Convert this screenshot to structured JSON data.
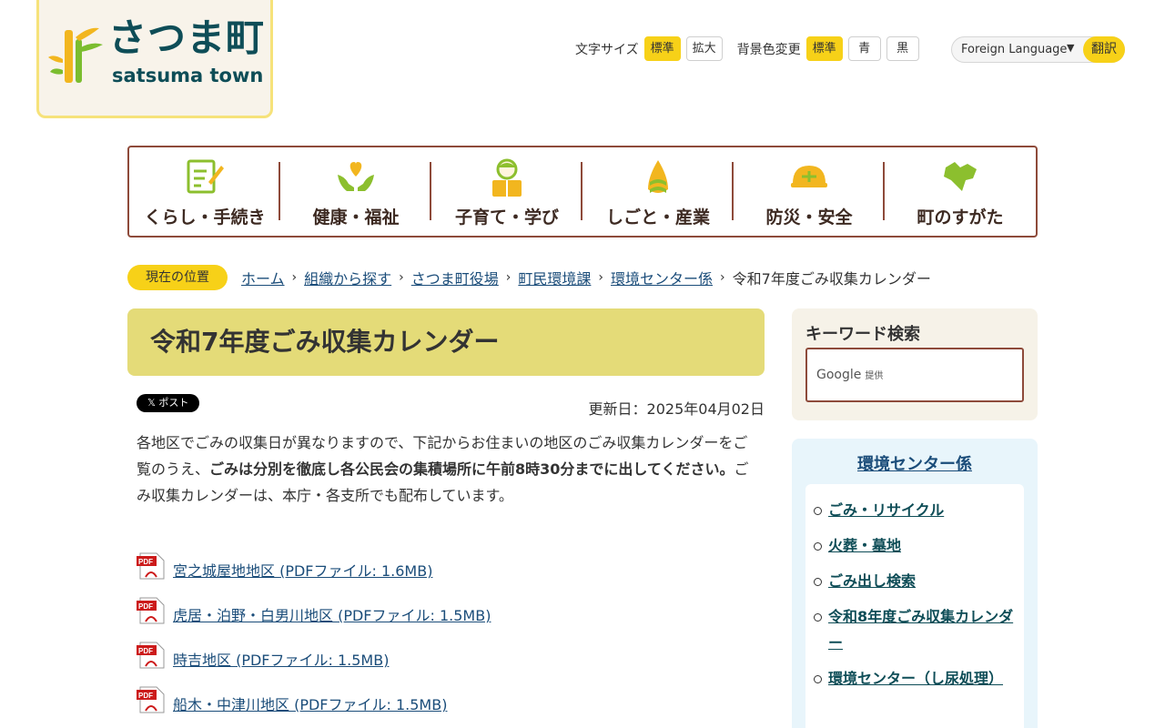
{
  "logo": {
    "jp": "さつま町",
    "en": "satsuma town"
  },
  "tools": {
    "font_label": "文字サイズ",
    "font_standard": "標準",
    "font_large": "拡大",
    "bg_label": "背景色変更",
    "bg_standard": "標準",
    "bg_blue": "青",
    "bg_black": "黒",
    "language_select": "Foreign Language",
    "translate": "翻訳"
  },
  "nav": [
    {
      "label": "くらし・手続き",
      "icon": "document-pen-icon"
    },
    {
      "label": "健康・福祉",
      "icon": "heart-hands-icon"
    },
    {
      "label": "子育て・学び",
      "icon": "child-book-icon"
    },
    {
      "label": "しごと・産業",
      "icon": "bamboo-shoot-icon"
    },
    {
      "label": "防災・安全",
      "icon": "helmet-icon"
    },
    {
      "label": "町のすがた",
      "icon": "town-map-icon"
    }
  ],
  "breadcrumb": {
    "here": "現在の位置",
    "items": [
      "ホーム",
      "組織から探す",
      "さつま町役場",
      "町民環境課",
      "環境センター係"
    ],
    "current": "令和7年度ごみ収集カレンダー"
  },
  "page": {
    "title": "令和7年度ごみ収集カレンダー",
    "post": "𝕏 ポスト",
    "updated": "更新日：2025年04月02日",
    "intro_1": "各地区でごみの収集日が異なりますので、下記からお住まいの地区のごみ収集カレンダーをご覧のうえ、",
    "intro_bold": "ごみは分別を徹底し各公民会の集積場所に午前8時30分までに出してください。",
    "intro_2": "ごみ収集カレンダーは、本庁・各支所でも配布しています。",
    "pdfs": [
      "宮之城屋地地区 (PDFファイル: 1.6MB)",
      "虎居・泊野・白男川地区 (PDFファイル: 1.5MB)",
      "時吉地区 (PDFファイル: 1.5MB)",
      "船木・中津川地区 (PDFファイル: 1.5MB)"
    ]
  },
  "search": {
    "title": "キーワード検索",
    "google": "Google",
    "provided": "提供"
  },
  "side": {
    "title": "環境センター係",
    "links": [
      "ごみ・リサイクル",
      "火葬・墓地",
      "ごみ出し検索",
      "令和8年度ごみ収集カレンダー",
      "環境センター（し尿処理）"
    ]
  },
  "colors": {
    "accent_yellow": "#f7d118",
    "nav_border": "#8e4a3a",
    "title_bg": "#e4db78",
    "link": "#1b4d7a"
  }
}
